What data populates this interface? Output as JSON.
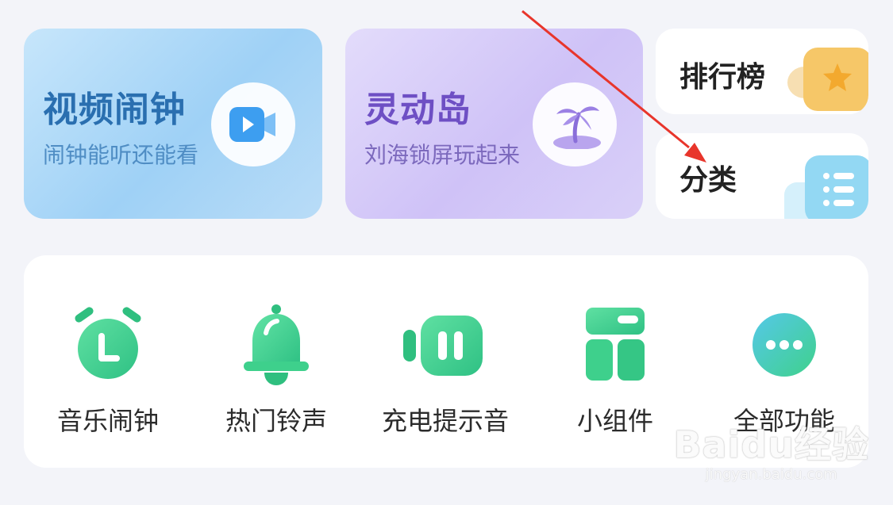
{
  "featured": {
    "video_alarm": {
      "title": "视频闹钟",
      "subtitle": "闹钟能听还能看",
      "icon": "video-play-icon"
    },
    "dynamic_island": {
      "title": "灵动岛",
      "subtitle": "刘海锁屏玩起来",
      "icon": "palm-island-icon"
    }
  },
  "side_cards": {
    "ranking": {
      "title": "排行榜",
      "icon": "star-icon"
    },
    "category": {
      "title": "分类",
      "icon": "list-icon"
    }
  },
  "shortcuts": [
    {
      "label": "音乐闹钟",
      "icon": "alarm-clock-icon"
    },
    {
      "label": "热门铃声",
      "icon": "bell-icon"
    },
    {
      "label": "充电提示音",
      "icon": "charging-icon"
    },
    {
      "label": "小组件",
      "icon": "widget-icon"
    },
    {
      "label": "全部功能",
      "icon": "more-icon"
    }
  ],
  "watermark": {
    "brand": "Baidu经验",
    "site": "jingyan.baidu.com"
  },
  "colors": {
    "background": "#f3f4f9",
    "accent_green": "#3ecf8e",
    "video_card": "#a9d7f7",
    "island_card": "#d3c7f8",
    "annotation_red": "#e8352b"
  }
}
